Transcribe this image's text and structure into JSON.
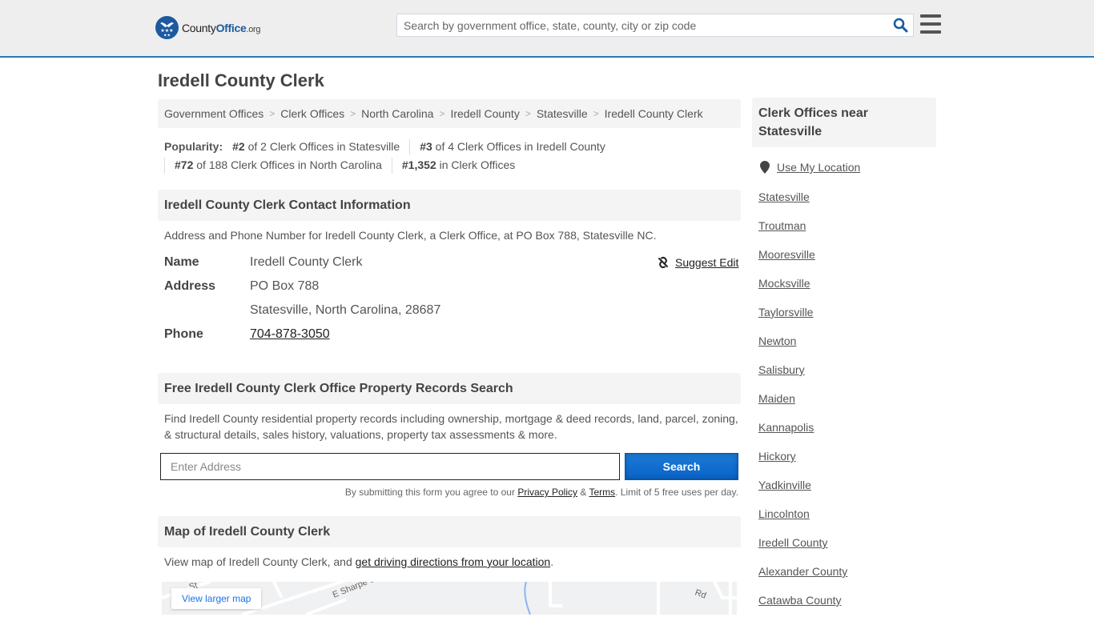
{
  "header": {
    "logo": {
      "name_part1": "County",
      "name_part2": "Office",
      "tld": ".org"
    },
    "search": {
      "placeholder": "Search by government office, state, county, city or zip code",
      "value": ""
    },
    "search_icon": "search-icon",
    "menu_icon": "hamburger-menu-icon"
  },
  "page": {
    "title": "Iredell County Clerk"
  },
  "breadcrumb": [
    "Government Offices",
    "Clerk Offices",
    "North Carolina",
    "Iredell County",
    "Statesville",
    "Iredell County Clerk"
  ],
  "breadcrumb_separator": ">",
  "popularity": {
    "label": "Popularity:",
    "items": [
      {
        "rank": "#2",
        "text": " of 2 Clerk Offices in Statesville"
      },
      {
        "rank": "#3",
        "text": " of 4 Clerk Offices in Iredell County"
      },
      {
        "rank": "#72",
        "text": " of 188 Clerk Offices in North Carolina"
      },
      {
        "rank": "#1,352",
        "text": " in Clerk Offices"
      }
    ]
  },
  "contact": {
    "heading": "Iredell County Clerk Contact Information",
    "description": "Address and Phone Number for Iredell County Clerk, a Clerk Office, at PO Box 788, Statesville NC.",
    "suggest_edit": "Suggest Edit",
    "fields": {
      "name_label": "Name",
      "name_value": "Iredell County Clerk",
      "address_label": "Address",
      "address_line1": "PO Box 788",
      "address_line2": "Statesville, North Carolina, 28687",
      "phone_label": "Phone",
      "phone_value": "704-878-3050"
    }
  },
  "property": {
    "heading": "Free Iredell County Clerk Office Property Records Search",
    "description": "Find Iredell County residential property records including ownership, mortgage & deed records, land, parcel, zoning, & structural details, sales history, valuations, property tax assessments & more.",
    "input_placeholder": "Enter Address",
    "input_value": "",
    "button_label": "Search",
    "disclaimer_pre": "By submitting this form you agree to our ",
    "privacy_link": "Privacy Policy",
    "amp": " & ",
    "terms_link": "Terms",
    "disclaimer_post": ". Limit of 5 free uses per day."
  },
  "map": {
    "heading": "Map of Iredell County Clerk",
    "description_pre": "View map of Iredell County Clerk, and ",
    "directions_link": "get driving directions from your location",
    "description_post": ".",
    "larger_map_link": "View larger map",
    "street_labels": [
      "E Sharpe St",
      "Rd",
      "St"
    ]
  },
  "sidebar": {
    "heading": "Clerk Offices near Statesville",
    "use_location": "Use My Location",
    "links": [
      "Statesville",
      "Troutman",
      "Mooresville",
      "Mocksville",
      "Taylorsville",
      "Newton",
      "Salisbury",
      "Maiden",
      "Kannapolis",
      "Hickory",
      "Yadkinville",
      "Lincolnton",
      "Iredell County",
      "Alexander County",
      "Catawba County"
    ]
  },
  "colors": {
    "brand_blue": "#1c5aa0",
    "header_border": "#2c79b5",
    "button_blue": "#0a63c6",
    "section_bg": "#f4f4f4"
  }
}
